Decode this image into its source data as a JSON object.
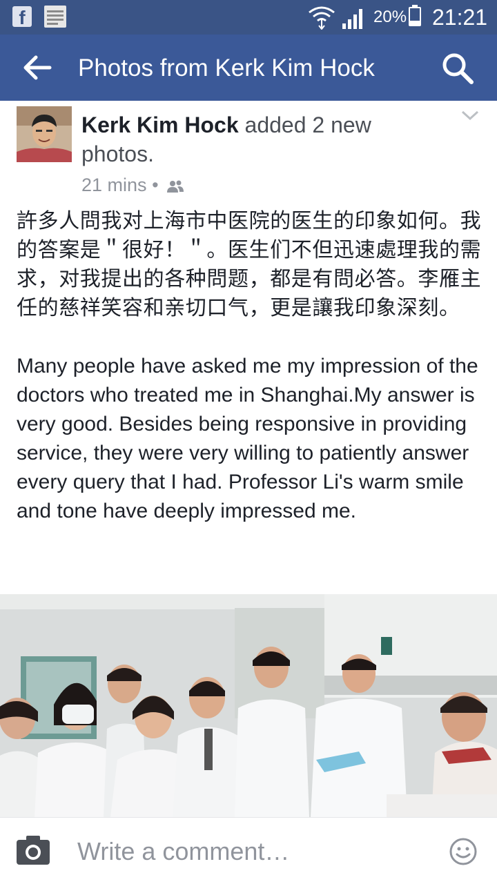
{
  "status_bar": {
    "battery_percent": "20%",
    "time": "21:21",
    "icons": [
      "facebook-icon",
      "news-app-icon",
      "wifi-icon",
      "signal-icon",
      "battery-icon"
    ]
  },
  "app_bar": {
    "title": "Photos from Kerk Kim Hock",
    "back_icon": "arrow-left-icon",
    "search_icon": "search-icon"
  },
  "post": {
    "author": "Kerk Kim Hock",
    "action": "added 2 new photos.",
    "timestamp": "21 mins",
    "separator": "•",
    "audience_icon": "friends-icon",
    "menu_icon": "chevron-down-icon",
    "text_zh": "許多人問我对上海市中医院的医生的印象如何。我的答案是＂很好！＂。医生们不但迅速處理我的需求，对我提出的各种問题，都是有問必答。李雁主任的慈祥笑容和亲切口气，更是讓我印象深刻。",
    "text_en": "Many people have asked me my impression of the doctors who treated me in Shanghai.My answer is very good. Besides being responsive in providing service, they were very willing to patiently answer every query that I had. Professor Li's warm smile and tone have deeply impressed me."
  },
  "photo": {
    "people_count": 9
  },
  "comment_bar": {
    "placeholder": "Write a comment…",
    "camera_icon": "camera-icon",
    "emoji_icon": "smiley-icon"
  }
}
